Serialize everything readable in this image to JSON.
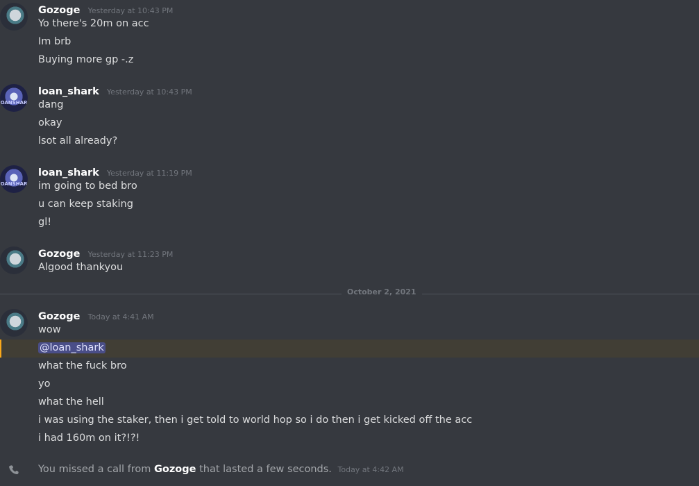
{
  "groups": [
    {
      "username": "Gozoge",
      "timestamp": "Yesterday at 10:43 PM",
      "messages": [
        "Yo there's 20m on acc",
        "Im brb",
        "Buying more gp -.z"
      ]
    },
    {
      "username": "loan_shark",
      "timestamp": "Yesterday at 10:43 PM",
      "messages": [
        "dang",
        "okay",
        "lsot all already?"
      ]
    },
    {
      "username": "loan_shark",
      "timestamp": "Yesterday at 11:19 PM",
      "messages": [
        "im going to bed bro",
        "u can keep staking",
        "gl!"
      ]
    },
    {
      "username": "Gozoge",
      "timestamp": "Yesterday at 11:23 PM",
      "messages": [
        "Algood thankyou"
      ]
    },
    {
      "username": "Gozoge",
      "timestamp": "Today at 4:41 AM",
      "messages": [
        "wow",
        "@loan_shark",
        "what the fuck bro",
        "yo",
        "what the hell",
        "i was using the staker, then i get told to world hop so i do then i get kicked off the acc",
        "i had 160m on it?!?!"
      ]
    }
  ],
  "date_divider": "October 2, 2021",
  "call": {
    "prefix": "You missed a call from",
    "caller": "Gozoge",
    "suffix": "that lasted a few seconds.",
    "timestamp": "Today at 4:42 AM"
  },
  "avatar_text": "OANSHAR",
  "colors": {
    "background": "#36393f",
    "mention_bg": "#413e35",
    "mention_bar": "#faa81a",
    "mention_pill": "#4a4e88"
  }
}
